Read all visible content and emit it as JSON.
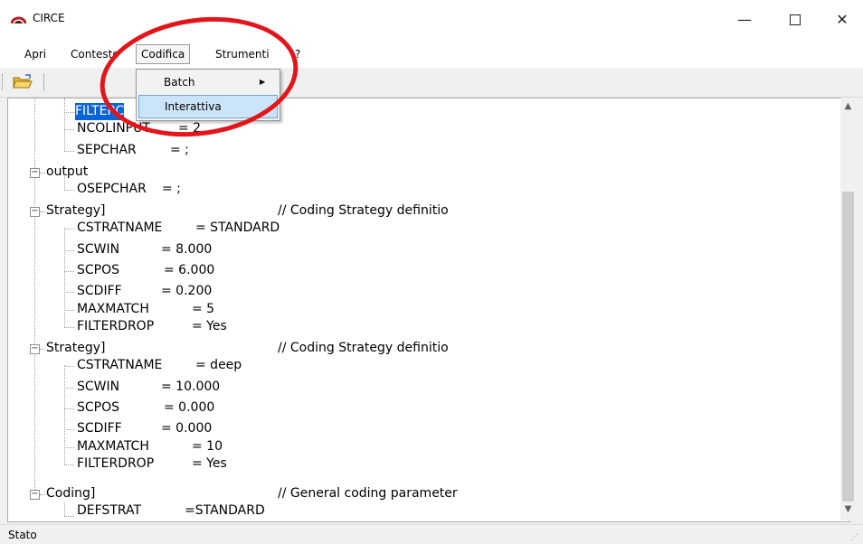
{
  "window": {
    "title": "CIRCE",
    "minimize": "—",
    "close": "✕"
  },
  "menu": [
    "Apri",
    "Contesto",
    "Codifica",
    "Strumenti",
    "?"
  ],
  "dropdown": {
    "items": [
      {
        "label": "Batch",
        "submenu": "▶"
      },
      {
        "label": "Interattiva"
      }
    ]
  },
  "tree": {
    "r0": {
      "key": "FILTERC"
    },
    "r1": {
      "key": "NCOLINPUT",
      "val": "= 2"
    },
    "r2": {
      "key": "SEPCHAR",
      "val": "= ;"
    },
    "r3": {
      "key": "output"
    },
    "r4": {
      "key": "OSEPCHAR",
      "val": "= ;"
    },
    "r5": {
      "key": "Strategy]",
      "cmt": "// Coding Strategy definitio"
    },
    "r6": {
      "key": "CSTRATNAME",
      "val": "= STANDARD"
    },
    "r7": {
      "key": "SCWIN",
      "val": "= 8.000"
    },
    "r8": {
      "key": "SCPOS",
      "val": "= 6.000"
    },
    "r9": {
      "key": "SCDIFF",
      "val": "= 0.200"
    },
    "r10": {
      "key": "MAXMATCH",
      "val": "= 5"
    },
    "r11": {
      "key": "FILTERDROP",
      "val": "= Yes"
    },
    "r12": {
      "key": "Strategy]",
      "cmt": "// Coding Strategy definitio"
    },
    "r13": {
      "key": "CSTRATNAME",
      "val": "= deep"
    },
    "r14": {
      "key": "SCWIN",
      "val": "= 10.000"
    },
    "r15": {
      "key": "SCPOS",
      "val": "= 0.000"
    },
    "r16": {
      "key": "SCDIFF",
      "val": "= 0.000"
    },
    "r17": {
      "key": "MAXMATCH",
      "val": "= 10"
    },
    "r18": {
      "key": "FILTERDROP",
      "val": "= Yes"
    },
    "r19": {
      "key": "Coding]",
      "cmt": "// General coding parameter"
    },
    "r20": {
      "key": "DEFSTRAT",
      "val": "=STANDARD"
    }
  },
  "expander": "−",
  "status": "Stato",
  "colors": {
    "highlight": "#0a64d6",
    "annotation": "#e3151a",
    "menu_selected": "#cce4f7"
  }
}
